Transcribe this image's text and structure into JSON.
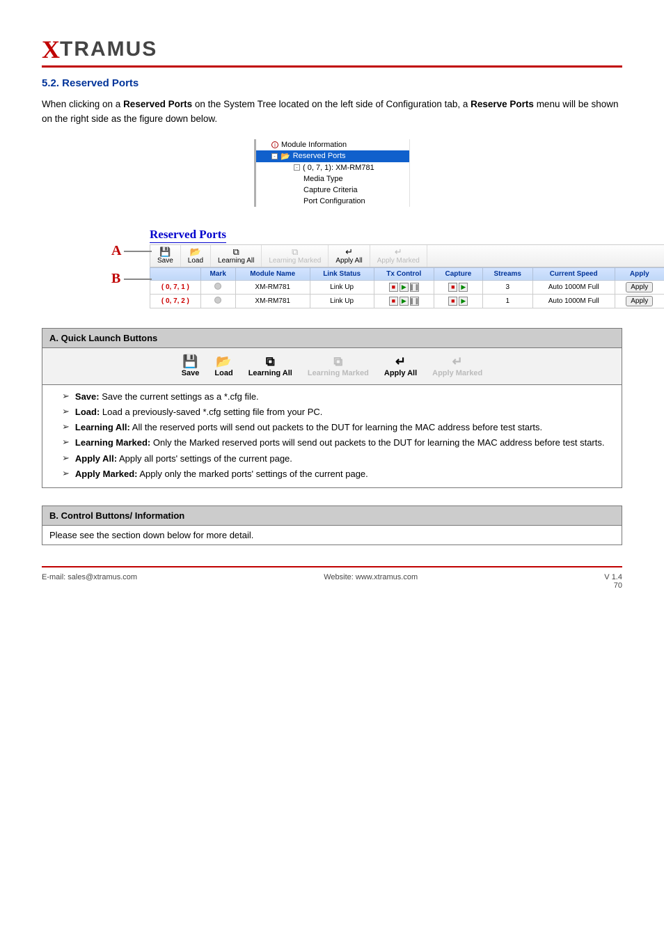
{
  "logo": {
    "x": "X",
    "tramus": "TRAMUS"
  },
  "heading": "5.2. Reserved Ports",
  "intro_a": "When clicking on a ",
  "intro_b": "Reserved Ports",
  "intro_c": " on the System Tree located on the left side of Configuration tab, a ",
  "intro_d": "Reserve Ports",
  "intro_e": " menu will be shown on the right side as the figure down below.",
  "tree": {
    "mod_info": "Module Information",
    "reserved": "Reserved Ports",
    "port": "( 0, 7, 1): XM-RM781",
    "media": "Media Type",
    "capture": "Capture Criteria",
    "portcfg": "Port Configuration"
  },
  "label_A": "A",
  "label_B": "B",
  "rp_title": "Reserved Ports",
  "toolbar": {
    "save": "Save",
    "load": "Load",
    "learn_all": "Learning All",
    "learn_marked": "Learning Marked",
    "apply_all": "Apply All",
    "apply_marked": "Apply Marked"
  },
  "table": {
    "h_blank": "",
    "h_mark": "Mark",
    "h_module": "Module Name",
    "h_link": "Link Status",
    "h_tx": "Tx Control",
    "h_capture": "Capture",
    "h_streams": "Streams",
    "h_current": "Current Speed",
    "h_apply": "Apply",
    "rows": [
      {
        "port": "( 0, 7, 1 )",
        "module": "XM-RM781",
        "link": "Link Up",
        "streams": "3",
        "speed": "Auto 1000M Full",
        "apply": "Apply"
      },
      {
        "port": "( 0, 7, 2 )",
        "module": "XM-RM781",
        "link": "Link Up",
        "streams": "1",
        "speed": "Auto 1000M Full",
        "apply": "Apply"
      }
    ]
  },
  "desc": {
    "header_a": "A. Quick Launch Buttons",
    "bullets": [
      {
        "b": "Save:",
        "t": " Save the current settings as a *.cfg file."
      },
      {
        "b": "Load:",
        "t": " Load a previously-saved *.cfg setting file from your PC."
      },
      {
        "b": "Learning All:",
        "t": " All the reserved ports will send out packets to the DUT for learning the MAC address before test starts."
      },
      {
        "b": "Learning Marked:",
        "t": " Only the Marked reserved ports will send out packets to the DUT for learning the MAC address before test starts."
      },
      {
        "b": "Apply All:",
        "t": " Apply all ports' settings of the current page."
      },
      {
        "b": "Apply Marked:",
        "t": " Apply only the marked ports' settings of the current page."
      }
    ],
    "header_b": "B. Control Buttons/ Information",
    "b_text": "Please see the section down below for more detail."
  },
  "footer": {
    "left": "E-mail: sales@xtramus.com",
    "center": "Website: www.xtramus.com",
    "right_line1": "V 1.4",
    "right_line2": "70"
  }
}
